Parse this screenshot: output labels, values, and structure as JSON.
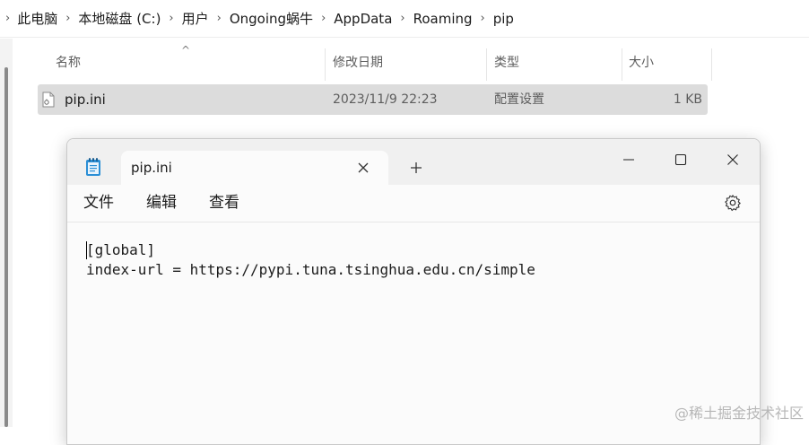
{
  "explorer": {
    "breadcrumb": [
      "此电脑",
      "本地磁盘 (C:)",
      "用户",
      "Ongoing蜗牛",
      "AppData",
      "Roaming",
      "pip"
    ],
    "columns": {
      "name": "名称",
      "modified": "修改日期",
      "type": "类型",
      "size": "大小"
    },
    "files": [
      {
        "name": "pip.ini",
        "modified": "2023/11/9 22:23",
        "type": "配置设置",
        "size": "1 KB",
        "icon": "ini-file-icon"
      }
    ]
  },
  "notepad": {
    "tab_title": "pip.ini",
    "menu": [
      "文件",
      "编辑",
      "查看"
    ],
    "lines": [
      "[global]",
      "index-url = https://pypi.tuna.tsinghua.edu.cn/simple"
    ],
    "colors": {
      "titlebar": "#f0f0f0",
      "editor": "#fbfbfb",
      "selected_row": "#dcdcdc"
    }
  },
  "watermark": "@稀土掘金技术社区"
}
